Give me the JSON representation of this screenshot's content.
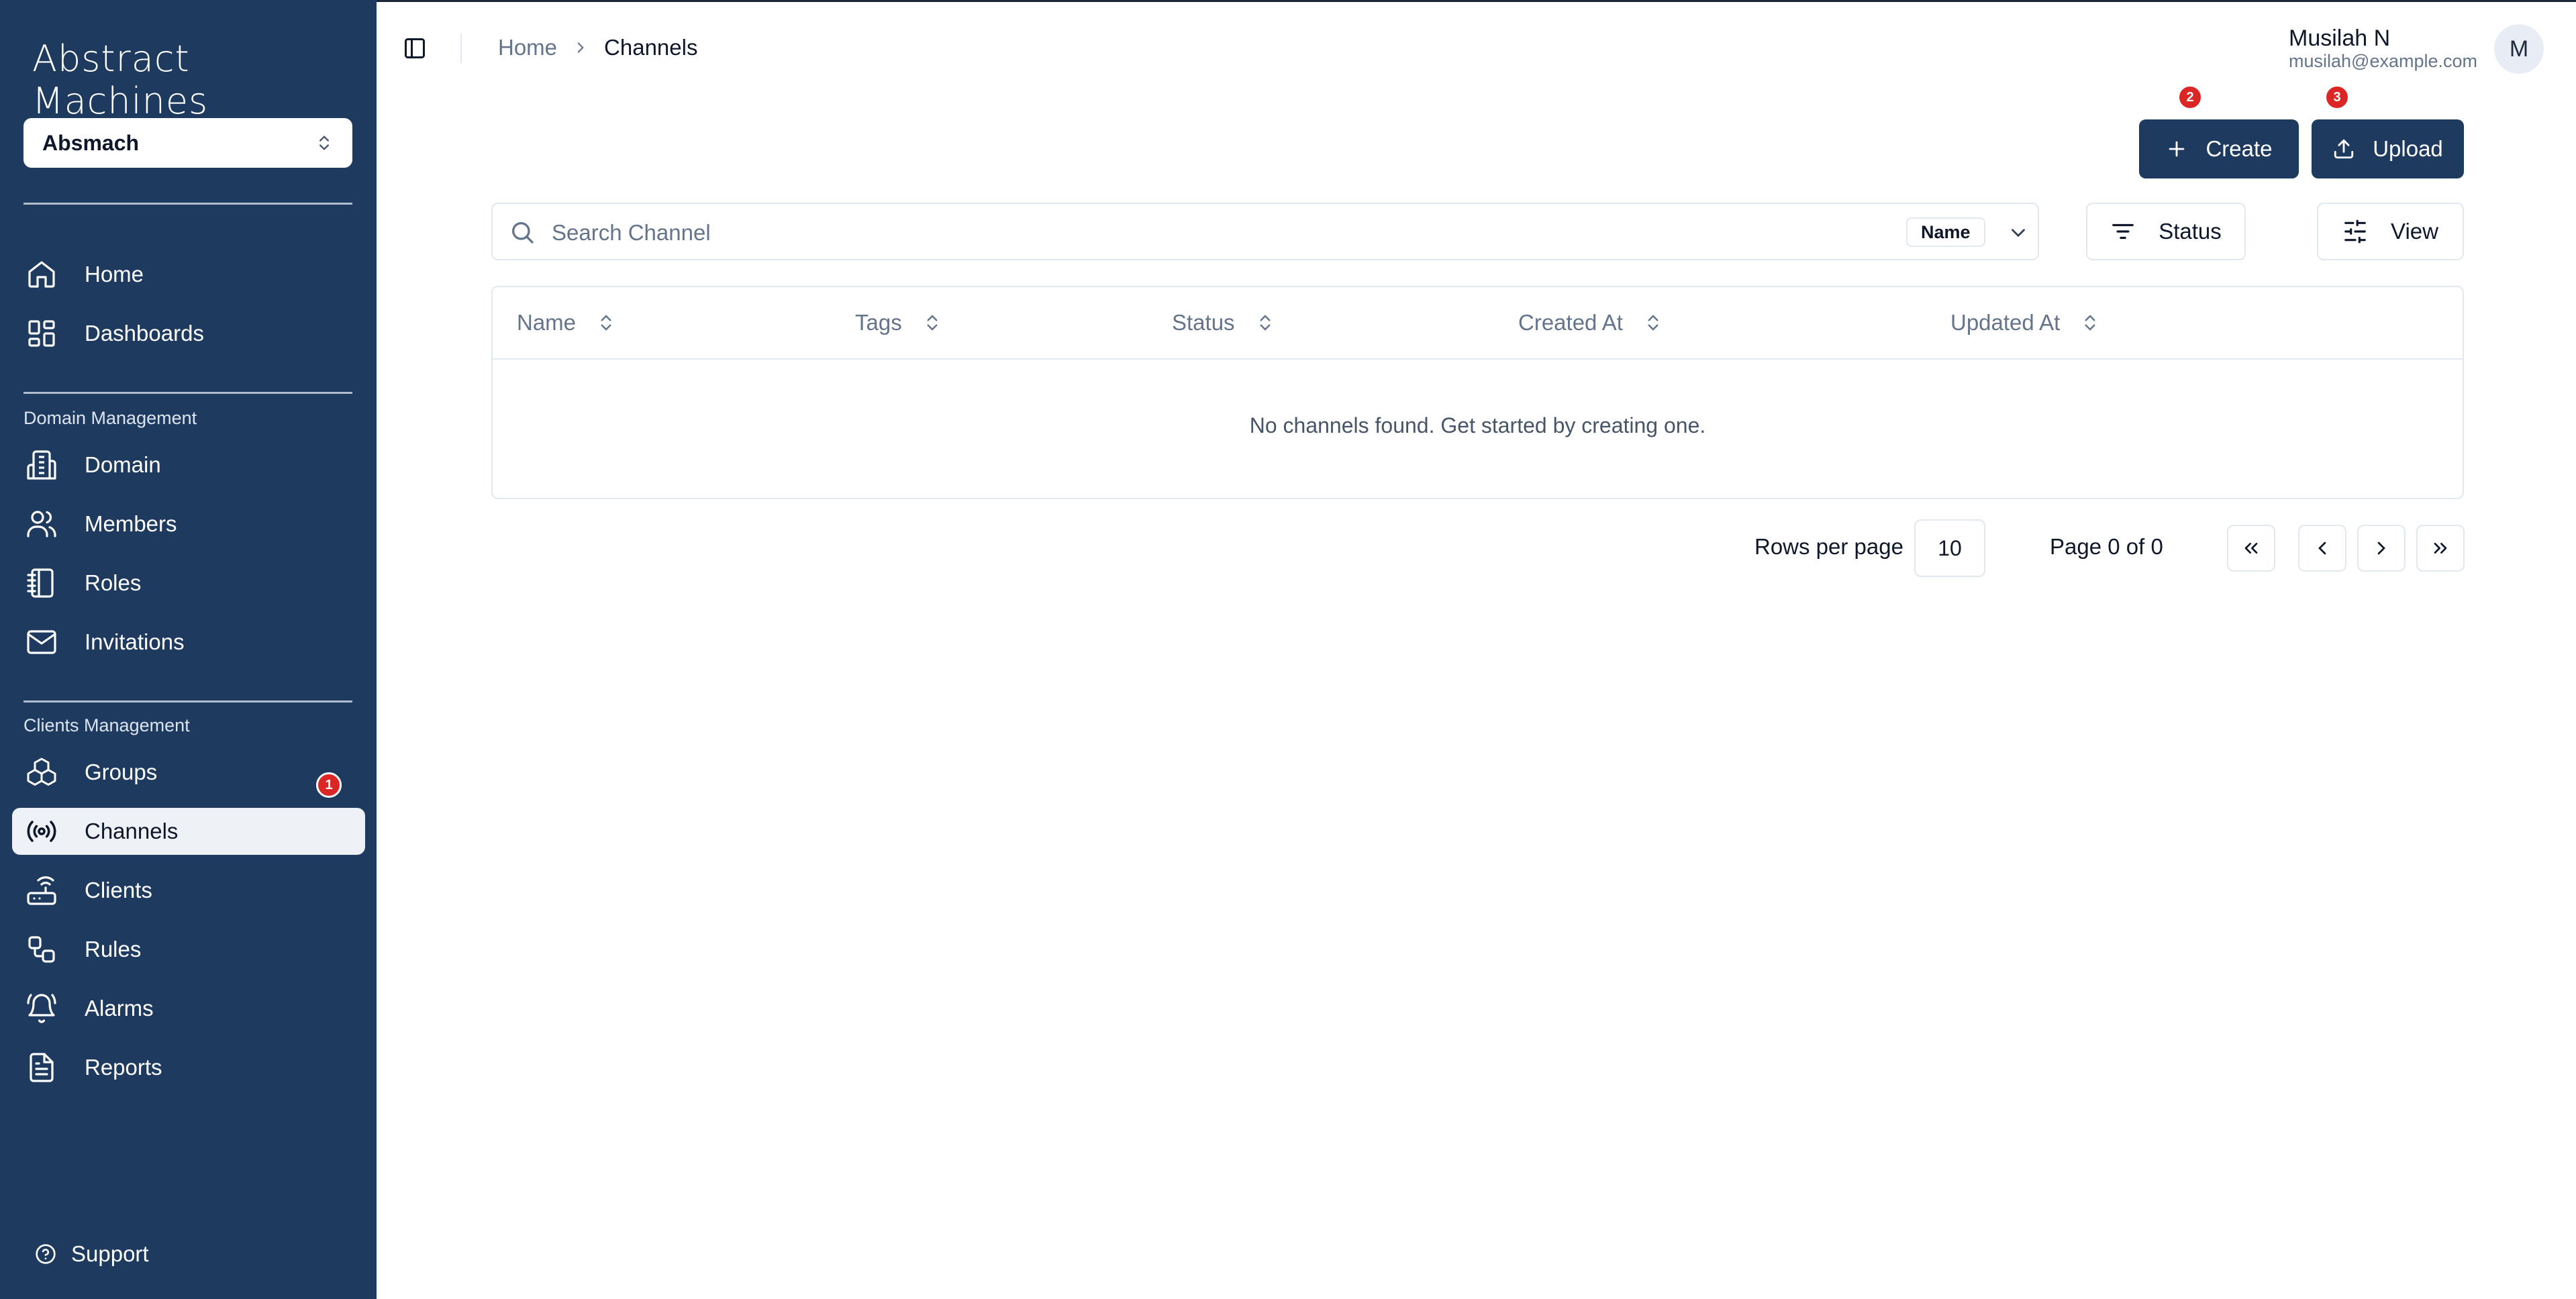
{
  "app": {
    "logo_text": "Abstract Machines"
  },
  "domain_selector": {
    "value": "Absmach"
  },
  "sidebar": {
    "main_items": [
      {
        "label": "Home",
        "icon": "home-icon"
      },
      {
        "label": "Dashboards",
        "icon": "dashboard-icon"
      }
    ],
    "domain_section": {
      "label": "Domain Management",
      "items": [
        {
          "label": "Domain",
          "icon": "building-icon"
        },
        {
          "label": "Members",
          "icon": "users-icon"
        },
        {
          "label": "Roles",
          "icon": "notebook-icon"
        },
        {
          "label": "Invitations",
          "icon": "mail-icon"
        }
      ]
    },
    "clients_section": {
      "label": "Clients Management",
      "items": [
        {
          "label": "Groups",
          "icon": "boxes-icon",
          "badge": "1"
        },
        {
          "label": "Channels",
          "icon": "radio-icon",
          "active": true
        },
        {
          "label": "Clients",
          "icon": "router-icon"
        },
        {
          "label": "Rules",
          "icon": "workflow-icon"
        },
        {
          "label": "Alarms",
          "icon": "bell-icon"
        },
        {
          "label": "Reports",
          "icon": "file-text-icon"
        }
      ]
    },
    "support_label": "Support"
  },
  "header": {
    "breadcrumb": {
      "home": "Home",
      "current": "Channels"
    },
    "user": {
      "name": "Musilah N",
      "email": "musilah@example.com",
      "initial": "M"
    }
  },
  "actions": {
    "create_label": "Create",
    "create_badge": "2",
    "upload_label": "Upload",
    "upload_badge": "3"
  },
  "search": {
    "placeholder": "Search Channel",
    "field": "Name"
  },
  "filters": {
    "status_label": "Status",
    "view_label": "View"
  },
  "table": {
    "columns": [
      "Name",
      "Tags",
      "Status",
      "Created At",
      "Updated At"
    ],
    "empty_message": "No channels found. Get started by creating one."
  },
  "pagination": {
    "rows_label": "Rows per page",
    "rows_value": "10",
    "page_info": "Page 0 of 0"
  },
  "colors": {
    "sidebar_bg": "#1e3a5f",
    "primary": "#1e3a5f",
    "badge": "#dc2626"
  }
}
